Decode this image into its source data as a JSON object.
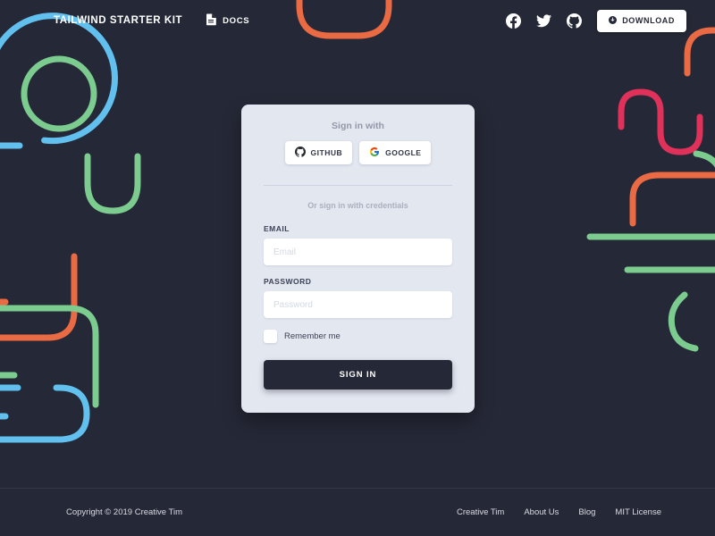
{
  "page": {
    "background_color": "#252836",
    "card_color": "#e3e7f0"
  },
  "navbar": {
    "brand": "TAILWIND STARTER KIT",
    "docs_label": "DOCS",
    "docs_icon": "document-icon",
    "social": [
      {
        "name": "facebook-icon",
        "label": "Facebook"
      },
      {
        "name": "twitter-icon",
        "label": "Twitter"
      },
      {
        "name": "github-icon",
        "label": "GitHub"
      }
    ],
    "download_label": "DOWNLOAD",
    "download_icon": "download-icon"
  },
  "login_card": {
    "heading": "Sign in with",
    "social_buttons": [
      {
        "label": "GITHUB",
        "icon": "github-icon"
      },
      {
        "label": "GOOGLE",
        "icon": "google-icon"
      }
    ],
    "credentials_note": "Or sign in with credentials",
    "email": {
      "label": "EMAIL",
      "placeholder": "Email",
      "value": ""
    },
    "password": {
      "label": "PASSWORD",
      "placeholder": "Password",
      "value": ""
    },
    "remember_me": {
      "label": "Remember me",
      "checked": false
    },
    "submit_label": "SIGN IN"
  },
  "footer": {
    "copyright": "Copyright © 2019 Creative Tim",
    "links": [
      {
        "label": "Creative Tim"
      },
      {
        "label": "About Us"
      },
      {
        "label": "Blog"
      },
      {
        "label": "MIT License"
      }
    ]
  },
  "decor_colors": {
    "blue": "#62c0ef",
    "green": "#7ccb8f",
    "orange": "#ea6a43",
    "crimson": "#e0315b"
  }
}
